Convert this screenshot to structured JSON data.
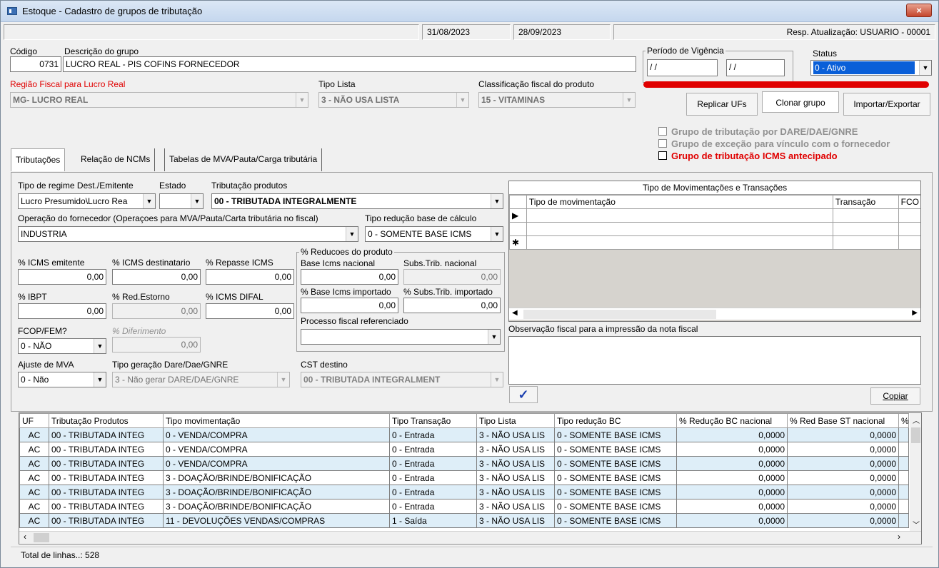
{
  "window": {
    "title": "Estoque - Cadastro de grupos de tributação",
    "close": "×"
  },
  "top_status": {
    "date1": "31/08/2023",
    "date2": "28/09/2023",
    "resp": "Resp. Atualização: USUARIO - 00001"
  },
  "form": {
    "codigo_label": "Código",
    "codigo": "0731",
    "descricao_label": "Descrição do grupo",
    "descricao": "LUCRO REAL - PIS COFINS FORNECEDOR",
    "periodo_label": "Período de Vigência",
    "periodo_ini": "/ /",
    "periodo_fim": "/ /",
    "status_label": "Status",
    "status": "0 - Ativo",
    "regiao_label": "Região Fiscal para Lucro Real",
    "regiao": "MG- LUCRO REAL",
    "tipo_lista_label": "Tipo Lista",
    "tipo_lista": "3 - NÃO USA LISTA",
    "classificacao_label": "Classificação fiscal do produto",
    "classificacao": "15 - VITAMINAS"
  },
  "buttons": {
    "replicar": "Replicar UFs",
    "clonar": "Clonar grupo",
    "importar": "Importar/Exportar",
    "copiar": "Copiar",
    "confirm": "✓"
  },
  "checks": {
    "c1": "Grupo de tributação por DARE/DAE/GNRE",
    "c2": "Grupo de exceção para vínculo com o fornecedor",
    "c3": "Grupo de tributação ICMS antecipado"
  },
  "tabs": [
    "Tributações",
    "Relação de NCMs",
    "Tabelas de MVA/Pauta/Carga tributária"
  ],
  "trib": {
    "regime_label": "Tipo de regime Dest./Emitente",
    "regime": "Lucro Presumido\\Lucro Rea",
    "estado_label": "Estado",
    "estado": "",
    "trib_prod_label": "Tributação produtos",
    "trib_prod": "00 - TRIBUTADA INTEGRALMENTE",
    "operacao_label": "Operação do fornecedor (Operaçoes para MVA/Pauta/Carta tributária no fiscal)",
    "operacao": "INDUSTRIA",
    "reducao_label": "Tipo redução base de cálculo",
    "reducao": "0 - SOMENTE BASE ICMS",
    "icms_emit_label": "% ICMS emitente",
    "icms_emit": "0,00",
    "icms_dest_label": "% ICMS destinatario",
    "icms_dest": "0,00",
    "repasse_label": "% Repasse ICMS",
    "repasse": "0,00",
    "ibpt_label": "% IBPT",
    "ibpt": "0,00",
    "red_estorno_label": "% Red.Estorno",
    "red_estorno": "0,00",
    "difal_label": "% ICMS DIFAL",
    "difal": "0,00",
    "fcop_label": "FCOP/FEM?",
    "fcop": "0 - NÃO",
    "diferimento_label": "% Diferimento",
    "diferimento": "0,00",
    "ajuste_label": "Ajuste de MVA",
    "ajuste": "0 - Não",
    "geracao_label": "Tipo geração Dare/Dae/GNRE",
    "geracao": "3 - Não gerar DARE/DAE/GNRE",
    "reducoes_label": "% Reducoes do produto",
    "base_nac_label": "Base Icms nacional",
    "base_nac": "0,00",
    "subs_nac_label": "Subs.Trib. nacional",
    "subs_nac": "0,00",
    "base_imp_label": "% Base Icms importado",
    "base_imp": "0,00",
    "subs_imp_label": "% Subs.Trib. importado",
    "subs_imp": "0,00",
    "processo_label": "Processo fiscal referenciado",
    "processo": "",
    "cst_label": "CST destino",
    "cst": "00 - TRIBUTADA INTEGRALMENT"
  },
  "mov_grid": {
    "title": "Tipo de Movimentações e Transações",
    "headers": [
      "Tipo de movimentação",
      "Transação",
      "FCO"
    ],
    "row_markers": [
      "▶",
      "",
      "✱"
    ]
  },
  "obs_label": "Observação fiscal para a impressão da nota fiscal",
  "bottom_grid": {
    "headers": [
      "UF",
      "Tributação Produtos",
      "Tipo movimentação",
      "Tipo Transação",
      "Tipo Lista",
      "Tipo redução BC",
      "% Redução BC nacional",
      "% Red Base ST nacional",
      "%"
    ],
    "rows": [
      [
        "AC",
        "00 - TRIBUTADA INTEG",
        "0   - VENDA/COMPRA",
        "0 - Entrada",
        "3 - NÃO USA LIS",
        "0 - SOMENTE BASE ICMS",
        "0,0000",
        "0,0000"
      ],
      [
        "AC",
        "00 - TRIBUTADA INTEG",
        "0   - VENDA/COMPRA",
        "0 - Entrada",
        "3 - NÃO USA LIS",
        "0 - SOMENTE BASE ICMS",
        "0,0000",
        "0,0000"
      ],
      [
        "AC",
        "00 - TRIBUTADA INTEG",
        "0   - VENDA/COMPRA",
        "0 - Entrada",
        "3 - NÃO USA LIS",
        "0 - SOMENTE BASE ICMS",
        "0,0000",
        "0,0000"
      ],
      [
        "AC",
        "00 - TRIBUTADA INTEG",
        "3   - DOAÇÃO/BRINDE/BONIFICAÇÃO",
        "0 - Entrada",
        "3 - NÃO USA LIS",
        "0 - SOMENTE BASE ICMS",
        "0,0000",
        "0,0000"
      ],
      [
        "AC",
        "00 - TRIBUTADA INTEG",
        "3   - DOAÇÃO/BRINDE/BONIFICAÇÃO",
        "0 - Entrada",
        "3 - NÃO USA LIS",
        "0 - SOMENTE BASE ICMS",
        "0,0000",
        "0,0000"
      ],
      [
        "AC",
        "00 - TRIBUTADA INTEG",
        "3   - DOAÇÃO/BRINDE/BONIFICAÇÃO",
        "0 - Entrada",
        "3 - NÃO USA LIS",
        "0 - SOMENTE BASE ICMS",
        "0,0000",
        "0,0000"
      ],
      [
        "AC",
        "00 - TRIBUTADA INTEG",
        "11 - DEVOLUÇÕES VENDAS/COMPRAS",
        "1 - Saída",
        "3 - NÃO USA LIS",
        "0 - SOMENTE BASE ICMS",
        "0,0000",
        "0,0000"
      ]
    ]
  },
  "total_linhas": "Total de linhas..: 528",
  "colors": {
    "accent_red": "#e00000",
    "status_blue": "#0a5fd8"
  }
}
